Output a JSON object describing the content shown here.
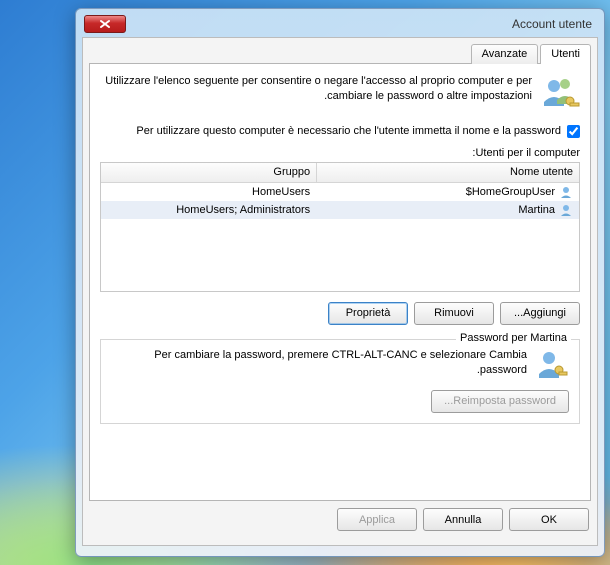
{
  "window": {
    "title": "Account utente"
  },
  "tabs": {
    "users": "Utenti",
    "advanced": "Avanzate"
  },
  "description": "Utilizzare l'elenco seguente per consentire o negare l'accesso al proprio computer e per cambiare le password o altre impostazioni.",
  "checkbox_label": "Per utilizzare questo computer è necessario che l'utente immetta il nome e la password",
  "users_label": "Utenti per il computer:",
  "columns": {
    "name": "Nome utente",
    "group": "Gruppo"
  },
  "rows": [
    {
      "name": "HomeGroupUser$",
      "group": "HomeUsers"
    },
    {
      "name": "Martina",
      "group": "HomeUsers; Administrators"
    }
  ],
  "buttons": {
    "add": "Aggiungi...",
    "remove": "Rimuovi",
    "properties": "Proprietà",
    "reset": "Reimposta password...",
    "ok": "OK",
    "cancel": "Annulla",
    "apply": "Applica"
  },
  "password_group": {
    "title": "Password per Martina",
    "text": "Per cambiare la password, premere CTRL-ALT-CANC e selezionare Cambia password."
  }
}
